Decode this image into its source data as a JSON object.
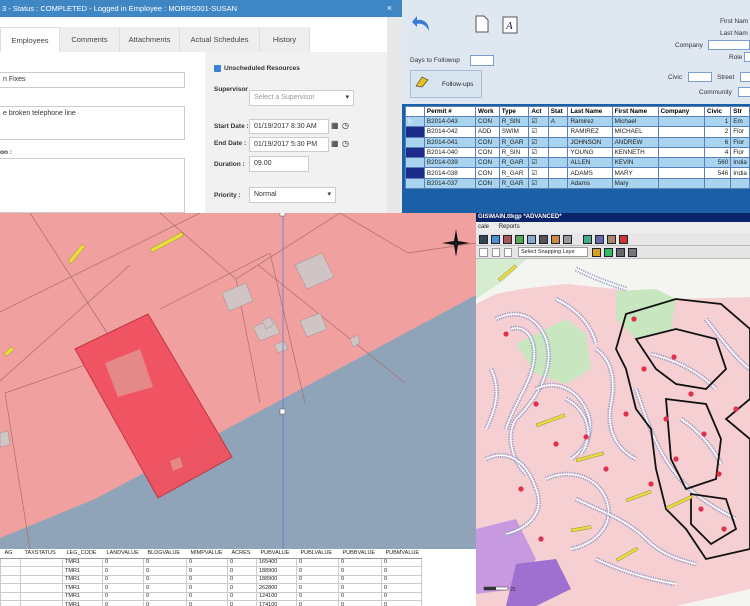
{
  "work_order": {
    "title": "3 - Status : COMPLETED - Logged in Employee : MORRS001-SUSAN",
    "close": "×",
    "tabs": [
      "Employees",
      "Comments",
      "Attachments",
      "Actual Schedules",
      "History"
    ],
    "description_value": "n Fixes",
    "comments_value": "e broken telephone line",
    "location_label": "on :",
    "unscheduled_label": "Unscheduled Resources",
    "supervisor_label": "Supervisor",
    "supervisor_placeholder": "Select a Supervisor",
    "start_label": "Start Date :",
    "start_value": "01/19/2017 8:30 AM",
    "end_label": "End Date :",
    "end_value": "01/19/2017 5:30 PM",
    "duration_label": "Duration :",
    "duration_value": "09.00",
    "priority_label": "Priority :",
    "priority_value": "Normal"
  },
  "permits": {
    "days_followup_label": "Days to Followup",
    "followups_button": "Follow-ups",
    "first_name_label": "First Nam",
    "last_name_label": "Last Nam",
    "company_label": "Company",
    "role_label": "Role",
    "civic_label": "Civic",
    "street_label": "Street",
    "community_label": "Community",
    "columns": [
      "",
      "Permit #",
      "Work",
      "Type",
      "Act",
      "Stat",
      "Last Name",
      "First Name",
      "Company",
      "Civic",
      "Str"
    ],
    "rows": [
      {
        "permit": "B2014-043",
        "work": "CON",
        "type": "R_SIN",
        "act": "☑",
        "stat": "A",
        "last": "Ramirez",
        "first": "Michael",
        "company": "",
        "civic": "1",
        "street": "Em"
      },
      {
        "permit": "B2014-042",
        "work": "ADD",
        "type": "SWIM",
        "act": "☑",
        "stat": "",
        "last": "RAMIREZ",
        "first": "MICHAEL",
        "company": "",
        "civic": "2",
        "street": "Flor"
      },
      {
        "permit": "B2014-041",
        "work": "CON",
        "type": "R_GAR",
        "act": "☑",
        "stat": "",
        "last": "JOHNSON",
        "first": "ANDREW",
        "company": "",
        "civic": "6",
        "street": "Flor"
      },
      {
        "permit": "B2014-040",
        "work": "CON",
        "type": "R_SIN",
        "act": "☑",
        "stat": "",
        "last": "YOUNG",
        "first": "KENNETH",
        "company": "",
        "civic": "4",
        "street": "Flor"
      },
      {
        "permit": "B2014-039",
        "work": "CON",
        "type": "R_GAR",
        "act": "☑",
        "stat": "",
        "last": "ALLEN",
        "first": "KEVIN",
        "company": "",
        "civic": "560",
        "street": "India"
      },
      {
        "permit": "B2014-038",
        "work": "CON",
        "type": "R_GAR",
        "act": "☑",
        "stat": "",
        "last": "ADAMS",
        "first": "MARY",
        "company": "",
        "civic": "546",
        "street": "India"
      },
      {
        "permit": "B2014-037",
        "work": "CON",
        "type": "R_GAR",
        "act": "☑",
        "stat": "",
        "last": "Adams",
        "first": "Mary",
        "company": "",
        "civic": "",
        "street": ""
      }
    ]
  },
  "attribute_table": {
    "columns": [
      "AG",
      "TAXSTATUS",
      "LEG_CODE",
      "LANDVALUE",
      "BLDGVALUE",
      "MIMPVALUE",
      "ACRES",
      "PUBVALUE",
      "PUBLVALUE",
      "PUBBVALUE",
      "PUBMVALUE"
    ],
    "rows": [
      [
        "",
        "",
        "TMR1",
        "0",
        "0",
        "0",
        "0",
        "165400",
        "0",
        "0",
        "0"
      ],
      [
        "",
        "",
        "TMR1",
        "0",
        "0",
        "0",
        "0",
        "188900",
        "0",
        "0",
        "0"
      ],
      [
        "",
        "",
        "TMR1",
        "0",
        "0",
        "0",
        "0",
        "188900",
        "0",
        "0",
        "0"
      ],
      [
        "",
        "",
        "TMR1",
        "0",
        "0",
        "0",
        "0",
        "262800",
        "0",
        "0",
        "0"
      ],
      [
        "",
        "",
        "TMR1",
        "0",
        "0",
        "0",
        "0",
        "124100",
        "0",
        "0",
        "0"
      ],
      [
        "",
        "",
        "TMR1",
        "0",
        "0",
        "0",
        "0",
        "174100",
        "0",
        "0",
        "0"
      ]
    ]
  },
  "gis": {
    "title": "GIS\\MAIN.ttkgp *ADVANCED*",
    "menu": [
      "cale",
      "Reports"
    ],
    "snapping_label": "Select Snapping Laye",
    "scale_label": "25"
  },
  "colors": {
    "title_bar": "#3f86c5",
    "parcel_fill": "#f1a0a0",
    "selected_parcel": "#f0505f",
    "water": "#8fa4b8",
    "grid_alt": "#a8d4f0"
  }
}
